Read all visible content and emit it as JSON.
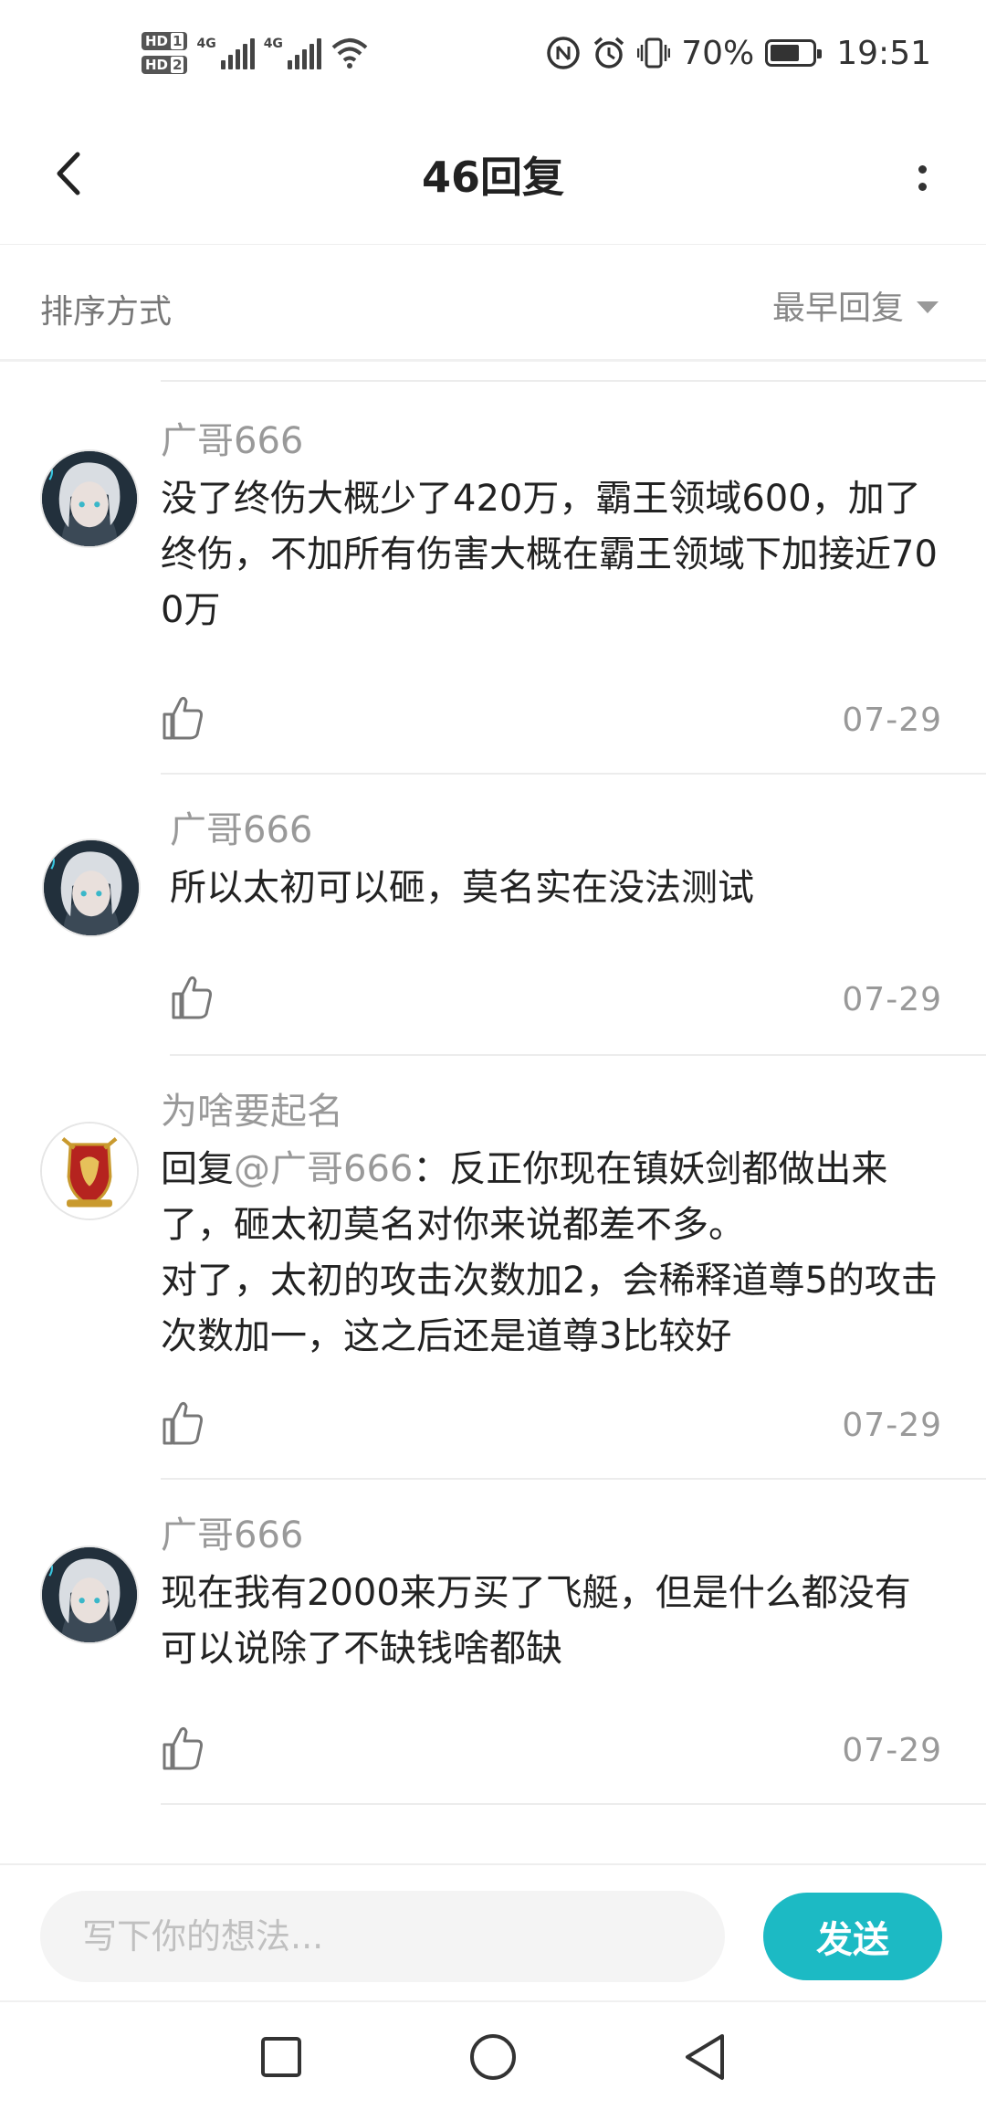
{
  "status_bar": {
    "sim1_label": "HD",
    "sim1_index": "1",
    "sim2_label": "HD",
    "sim2_index": "2",
    "net1": "4G",
    "net2": "4G",
    "battery_percent": "70%",
    "battery_level": 0.7,
    "time": "19:51",
    "icons": [
      "signal-icon",
      "wifi-icon",
      "nfc-icon",
      "alarm-icon",
      "vibrate-icon",
      "battery-icon"
    ]
  },
  "header": {
    "title": "46回复",
    "back_icon": "chevron-left-icon",
    "more_icon": "more-vertical-icon"
  },
  "sort": {
    "label": "排序方式",
    "selected": "最早回复"
  },
  "comments": [
    {
      "author": "广哥666",
      "avatar": "anime-character-avatar",
      "text": "没了终伤大概少了420万，霸王领域600，加了终伤，不加所有伤害大概在霸王领域下加接近700万",
      "date": "07-29"
    },
    {
      "author": "广哥666",
      "avatar": "anime-character-avatar",
      "text": "所以太初可以砸，莫名实在没法测试",
      "date": "07-29"
    },
    {
      "author": "为啥要起名",
      "avatar": "crest-avatar",
      "reply_prefix": "回复",
      "mention": "@广哥666",
      "text": "：反正你现在镇妖剑都做出来了，砸太初莫名对你来说都差不多。\n对了，太初的攻击次数加2，会稀释道尊5的攻击次数加一，这之后还是道尊3比较好",
      "date": "07-29"
    },
    {
      "author": "广哥666",
      "avatar": "anime-character-avatar",
      "text": "现在我有2000来万买了飞艇，但是什么都没有可以说除了不缺钱啥都缺",
      "date": "07-29"
    }
  ],
  "composer": {
    "placeholder": "写下你的想法...",
    "send_label": "发送",
    "accent_color": "#1cbac4"
  },
  "nav": {
    "icons": [
      "recent-apps-icon",
      "home-icon",
      "back-triangle-icon"
    ]
  }
}
